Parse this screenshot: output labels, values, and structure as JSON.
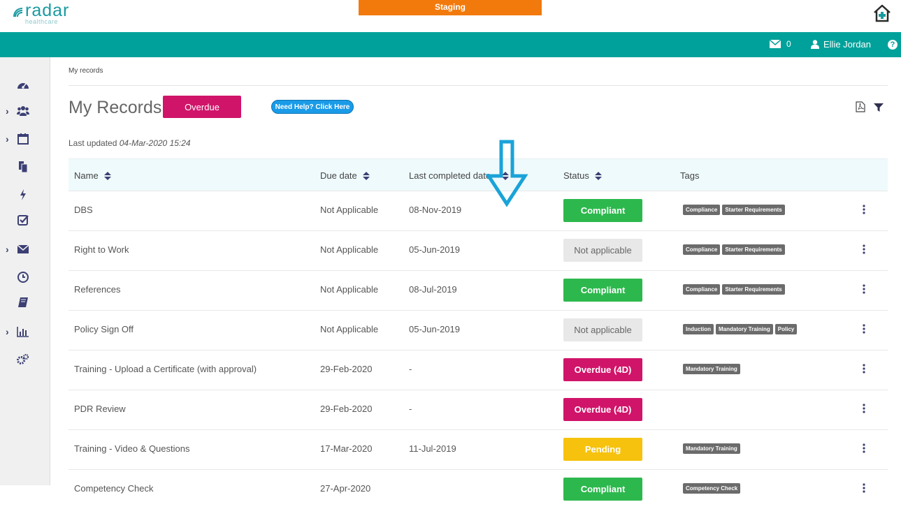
{
  "header": {
    "logo_text": "radar",
    "logo_sub": "healthcare",
    "environment_label": "Staging",
    "home_icon": "home-plus-icon",
    "mail_count": "0",
    "user_name": "Ellie Jordan",
    "help_glyph": "?"
  },
  "colors": {
    "teal": "#00a19a",
    "staging_orange": "#f27a0c",
    "overdue": "#d0146a",
    "compliant": "#2db84d",
    "pending": "#f6c20d",
    "arrow": "#1aa3d8"
  },
  "sidebar": {
    "items": [
      {
        "icon": "dashboard-icon",
        "expandable": false
      },
      {
        "icon": "users-icon",
        "expandable": true
      },
      {
        "icon": "calendar-icon",
        "expandable": true
      },
      {
        "icon": "documents-icon",
        "expandable": false
      },
      {
        "icon": "bolt-icon",
        "expandable": false
      },
      {
        "icon": "checkbox-icon",
        "expandable": false
      },
      {
        "icon": "mail-icon",
        "expandable": true
      },
      {
        "icon": "clock-icon",
        "expandable": false
      },
      {
        "icon": "book-icon",
        "expandable": false
      },
      {
        "icon": "bar-chart-icon",
        "expandable": true
      },
      {
        "icon": "settings-icon",
        "expandable": false
      }
    ]
  },
  "main": {
    "breadcrumb": "My records",
    "title": "My Records",
    "overdue_button": "Overdue",
    "help_button": "Need Help? Click Here",
    "last_updated_label": "Last updated",
    "last_updated_value": "04-Mar-2020 15:24"
  },
  "table": {
    "columns": [
      "Name",
      "Due date",
      "Last completed date",
      "Status",
      "Tags"
    ],
    "rows": [
      {
        "name": "DBS",
        "due": "Not Applicable",
        "completed": "08-Nov-2019",
        "status": "Compliant",
        "status_type": "compliant",
        "tags": [
          "Compliance",
          "Starter Requirements"
        ]
      },
      {
        "name": "Right to Work",
        "due": "Not Applicable",
        "completed": "05-Jun-2019",
        "status": "Not applicable",
        "status_type": "na",
        "tags": [
          "Compliance",
          "Starter Requirements"
        ]
      },
      {
        "name": "References",
        "due": "Not Applicable",
        "completed": "08-Jul-2019",
        "status": "Compliant",
        "status_type": "compliant",
        "tags": [
          "Compliance",
          "Starter Requirements"
        ]
      },
      {
        "name": "Policy Sign Off",
        "due": "Not Applicable",
        "completed": "05-Jun-2019",
        "status": "Not applicable",
        "status_type": "na",
        "tags": [
          "Induction",
          "Mandatory Training",
          "Policy"
        ]
      },
      {
        "name": "Training - Upload a Certificate (with approval)",
        "due": "29-Feb-2020",
        "completed": "-",
        "status": "Overdue (4D)",
        "status_type": "overdue",
        "tags": [
          "Mandatory Training"
        ]
      },
      {
        "name": "PDR Review",
        "due": "29-Feb-2020",
        "completed": "-",
        "status": "Overdue (4D)",
        "status_type": "overdue",
        "tags": []
      },
      {
        "name": "Training - Video & Questions",
        "due": "17-Mar-2020",
        "completed": "11-Jul-2019",
        "status": "Pending",
        "status_type": "pending",
        "tags": [
          "Mandatory Training"
        ]
      },
      {
        "name": "Competency Check",
        "due": "27-Apr-2020",
        "completed": "",
        "status": "Compliant",
        "status_type": "compliant",
        "tags": [
          "Competency Check"
        ]
      }
    ]
  }
}
